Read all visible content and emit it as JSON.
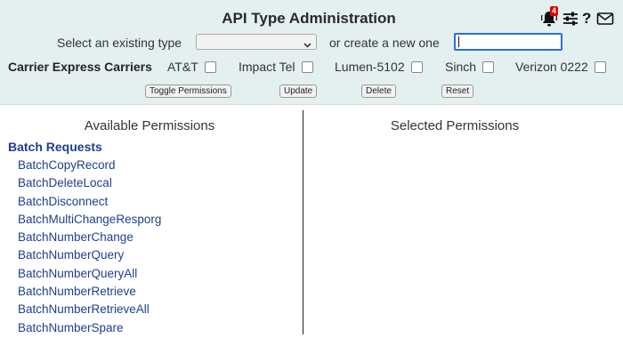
{
  "header": {
    "title": "API Type Administration",
    "notification_count": "4",
    "help_symbol": "?",
    "icons": [
      "bell-icon",
      "sliders-icon",
      "help-icon",
      "mail-icon"
    ]
  },
  "type_selector": {
    "select_label": "Select an existing type",
    "selected_value": "",
    "create_label": "or create a new one",
    "new_type_value": ""
  },
  "carriers": {
    "label": "Carrier Express Carriers",
    "items": [
      {
        "name": "AT&T",
        "checked": false
      },
      {
        "name": "Impact Tel",
        "checked": false
      },
      {
        "name": "Lumen-5102",
        "checked": false
      },
      {
        "name": "Sinch",
        "checked": false
      },
      {
        "name": "Verizon 0222",
        "checked": false
      }
    ]
  },
  "actions": {
    "toggle": "Toggle Permissions",
    "update": "Update",
    "delete": "Delete",
    "reset": "Reset"
  },
  "available": {
    "heading": "Available Permissions",
    "group": "Batch Requests",
    "items": [
      "BatchCopyRecord",
      "BatchDeleteLocal",
      "BatchDisconnect",
      "BatchMultiChangeResporg",
      "BatchNumberChange",
      "BatchNumberQuery",
      "BatchNumberQueryAll",
      "BatchNumberRetrieve",
      "BatchNumberRetrieveAll",
      "BatchNumberSpare"
    ]
  },
  "selected": {
    "heading": "Selected Permissions"
  },
  "colors": {
    "header_bg": "#e3f0ef",
    "link_blue": "#1e3f8e",
    "input_focus": "#2b6fd8",
    "badge_red": "#e00000"
  }
}
